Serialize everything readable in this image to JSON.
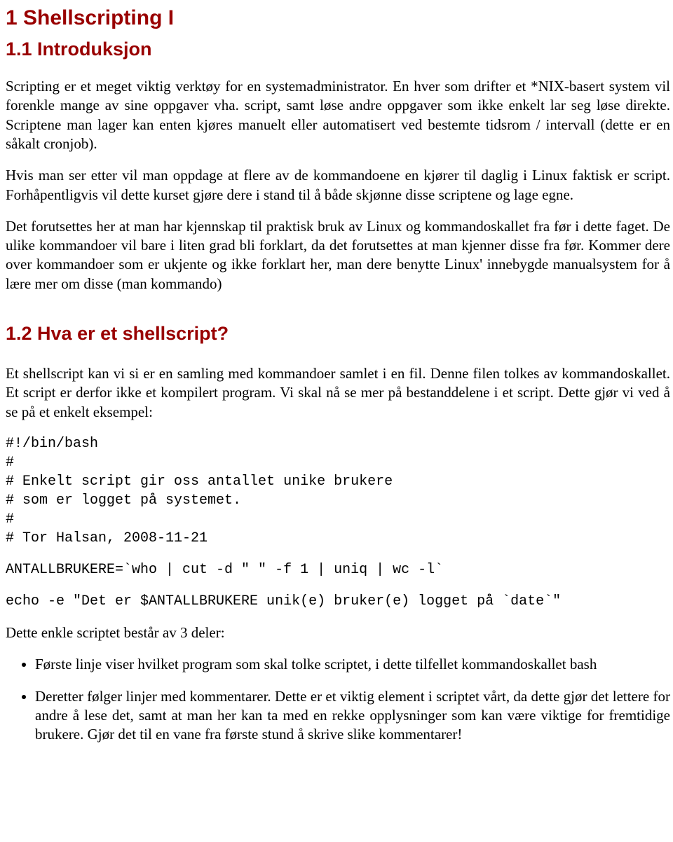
{
  "title": "1 Shellscripting I",
  "sections": {
    "intro": {
      "heading": "1.1 Introduksjon",
      "p1": "Scripting er et meget viktig verktøy for en systemadministrator. En hver som drifter et *NIX-basert system vil forenkle mange av sine oppgaver vha. script, samt løse andre oppgaver som ikke enkelt lar seg løse direkte. Scriptene man lager kan enten kjøres manuelt eller automatisert ved bestemte tidsrom / intervall (dette er en såkalt cronjob).",
      "p2": "Hvis man ser etter vil man oppdage at flere av de kommandoene en kjører til daglig i Linux faktisk er script. Forhåpentligvis vil dette kurset gjøre dere i stand til å både skjønne disse scriptene og lage egne.",
      "p3": "Det forutsettes her at man har kjennskap til praktisk bruk av Linux og kommandoskallet fra før i dette faget. De ulike kommandoer vil bare i liten grad bli forklart, da det forutsettes at man kjenner disse fra før. Kommer dere over kommandoer som er ukjente og ikke forklart her, man dere benytte Linux' innebygde manualsystem for å lære mer om disse (man kommando)"
    },
    "what": {
      "heading": "1.2 Hva er et shellscript?",
      "p1": "Et shellscript kan vi si er en samling med kommandoer samlet i en fil. Denne filen tolkes av kommandoskallet. Et script er derfor ikke et kompilert program. Vi skal nå se mer på bestanddelene i et script. Dette gjør vi ved å se på et enkelt eksempel:",
      "code1": "#!/bin/bash\n#\n# Enkelt script gir oss antallet unike brukere\n# som er logget på systemet.\n#\n# Tor Halsan, 2008-11-21",
      "code2": "ANTALLBRUKERE=`who | cut -d \" \" -f 1 | uniq | wc -l`",
      "code3": "echo -e \"Det er $ANTALLBRUKERE unik(e) bruker(e) logget på `date`\"",
      "p2": "Dette enkle scriptet består av 3 deler:",
      "bullets": [
        "Første linje viser hvilket program som skal tolke scriptet, i dette tilfellet kommandoskallet bash",
        "Deretter følger linjer med kommentarer. Dette er et viktig element i scriptet vårt, da dette gjør det lettere for andre å lese det, samt at man her kan ta med en rekke opplysninger som kan være viktige for fremtidige brukere. Gjør det til en vane fra første stund å skrive slike kommentarer!"
      ]
    }
  }
}
